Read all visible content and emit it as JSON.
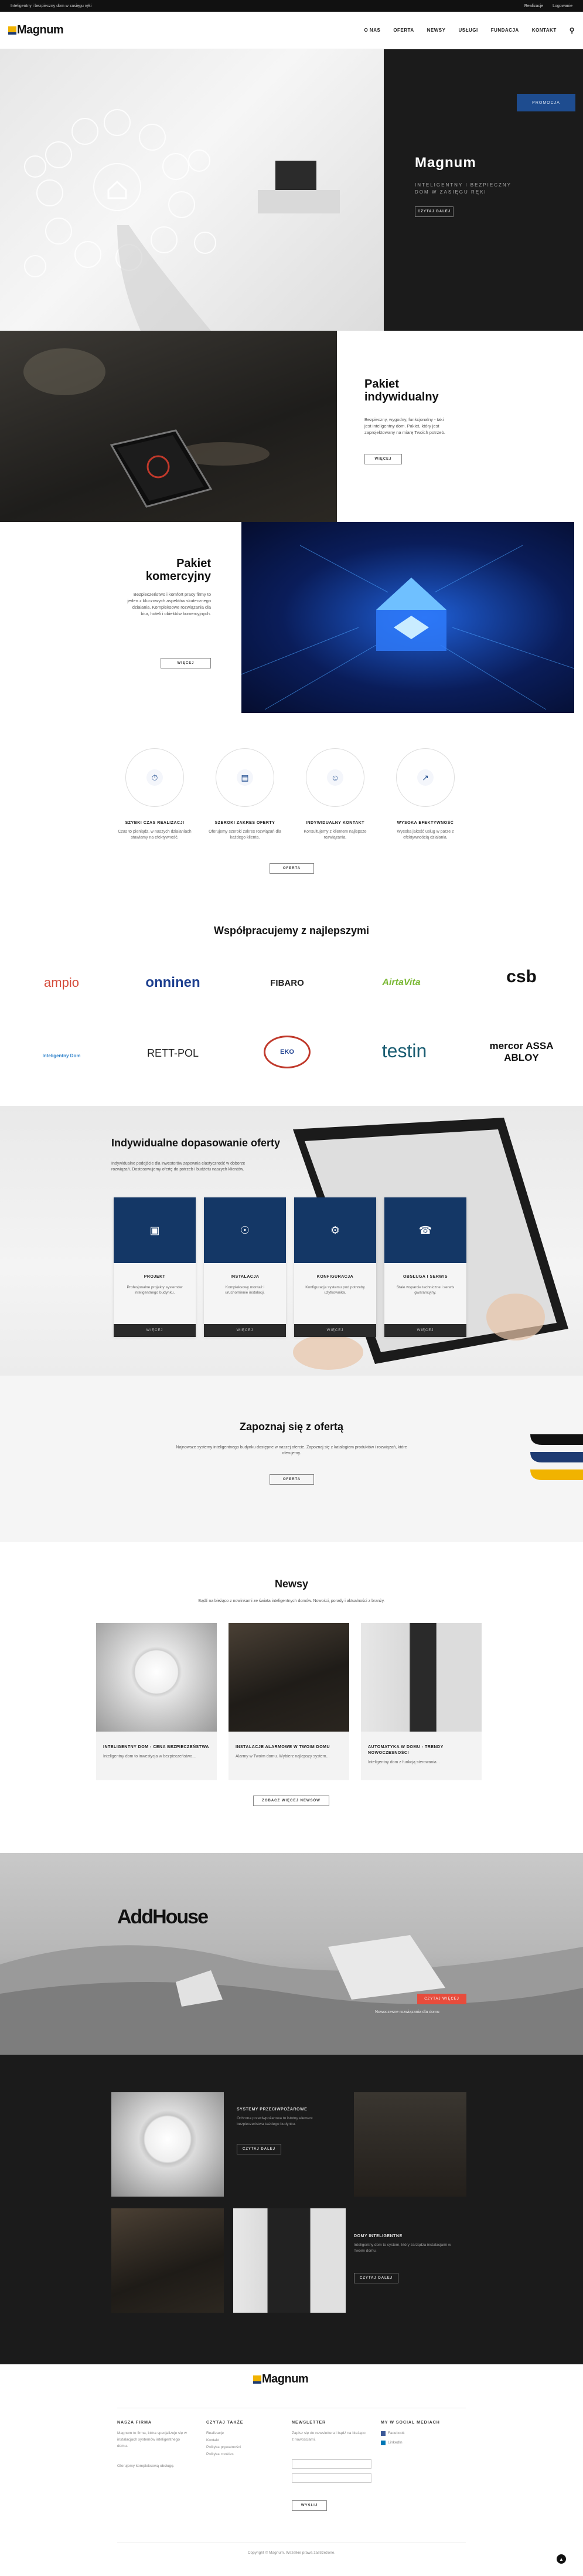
{
  "topbar": {
    "left_text": "Inteligentny i bezpieczny dom w zasięgu ręki",
    "links": [
      "Realizacje",
      "Logowanie"
    ]
  },
  "header": {
    "brand": "Magnum",
    "nav": [
      "O NAS",
      "OFERTA",
      "NEWSY",
      "USŁUGI",
      "FUNDACJA",
      "KONTAKT"
    ]
  },
  "hero": {
    "badge": "PROMOCJA",
    "title": "Magnum",
    "subtitle": "INTELIGENTNY I BEZPIECZNY DOM W ZASIĘGU RĘKI",
    "button": "CZYTAJ DALEJ"
  },
  "pakiet_ind": {
    "title": "Pakiet indywidualny",
    "text": "Bezpieczny, wygodny, funkcjonalny - taki jest inteligentny dom. Pakiet, który jest zaprojektowany na miarę Twoich potrzeb.",
    "button": "WIĘCEJ"
  },
  "pakiet_kom": {
    "title": "Pakiet komercyjny",
    "text": "Bezpieczeństwo i komfort pracy firmy to jeden z kluczowych aspektów skutecznego działania. Kompleksowe rozwiązania dla biur, hoteli i obiektów komercyjnych.",
    "button": "WIĘCEJ"
  },
  "features": {
    "items": [
      {
        "icon": "timer-icon",
        "title": "SZYBKI CZAS REALIZACJI",
        "text": "Czas to pieniądz, w naszych działaniach stawiamy na efektywność."
      },
      {
        "icon": "calendar-icon",
        "title": "SZEROKI ZAKRES OFERTY",
        "text": "Oferujemy szeroki zakres rozwiązań dla każdego klienta."
      },
      {
        "icon": "contact-icon",
        "title": "INDYWIDUALNY KONTAKT",
        "text": "Konsultujemy z klientem najlepsze rozwiązania."
      },
      {
        "icon": "chart-icon",
        "title": "WYSOKA EFEKTYWNOŚĆ",
        "text": "Wysoka jakość usług w parze z efektywnością działania."
      }
    ],
    "button": "OFERTA"
  },
  "partners": {
    "title": "Współpracujemy z najlepszymi",
    "logos": [
      "ampio",
      "onninen",
      "FIBARO",
      "AirtaVita",
      "csb",
      "Inteligentny Dom",
      "RETT-POL",
      "EKO",
      "testin",
      "mercor ASSA ABLOY"
    ]
  },
  "dopasowanie": {
    "title": "Indywidualne dopasowanie oferty",
    "text": "Indywidualne podejście dla inwestorów zapewnia elastyczność w doborze rozwiązań. Dostosowujemy ofertę do potrzeb i budżetu naszych klientów.",
    "cards": [
      {
        "icon": "project-icon",
        "title": "PROJEKT",
        "text": "Profesjonalne projekty systemów inteligentnego budynku.",
        "more": "WIĘCEJ"
      },
      {
        "icon": "install-icon",
        "title": "INSTALACJA",
        "text": "Kompleksowy montaż i uruchomienie instalacji.",
        "more": "WIĘCEJ"
      },
      {
        "icon": "gear-icon",
        "title": "KONFIGURACJA",
        "text": "Konfiguracja systemu pod potrzeby użytkownika.",
        "more": "WIĘCEJ"
      },
      {
        "icon": "phone-icon",
        "title": "OBSŁUGA I SERWIS",
        "text": "Stałe wsparcie techniczne i serwis gwarancyjny.",
        "more": "WIĘCEJ"
      }
    ]
  },
  "zapoznaj": {
    "title": "Zapoznaj się z ofertą",
    "text": "Najnowsze systemy inteligentnego budynku dostępne w naszej ofercie. Zapoznaj się z katalogiem produktów i rozwiązań, które oferujemy.",
    "button": "OFERTA"
  },
  "news": {
    "title": "Newsy",
    "text": "Bądź na bieżąco z nowinkami ze świata inteligentnych domów. Nowości, porady i aktualności z branży.",
    "items": [
      {
        "title": "INTELIGENTNY DOM - CENA BEZPIECZEŃSTWA",
        "text": "Inteligentny dom to inwestycja w bezpieczeństwo..."
      },
      {
        "title": "INSTALACJE ALARMOWE W TWOIM DOMU",
        "text": "Alarmy w Twoim domu. Wybierz najlepszy system..."
      },
      {
        "title": "AUTOMATYKA W DOMU - TRENDY NOWOCZESNOŚCI",
        "text": "Inteligentny dom z funkcją sterowania..."
      }
    ],
    "button": "ZOBACZ WIĘCEJ NEWSÓW"
  },
  "addhouse": {
    "brand": "AddHouse",
    "button": "CZYTAJ WIĘCEJ",
    "text": "Nowoczesne rozwiązania dla domu"
  },
  "promo": {
    "items": [
      {
        "title": "SYSTEMY PRZECIWPOŻAROWE",
        "text": "Ochrona przeciwpożarowa to istotny element bezpieczeństwa każdego budynku.",
        "button": "CZYTAJ DALEJ"
      },
      {
        "title": "DOMY INTELIGENTNE",
        "text": "Inteligentny dom to system, który zarządza instalacjami w Twoim domu.",
        "button": "CZYTAJ DALEJ"
      }
    ]
  },
  "footer": {
    "brand": "Magnum",
    "cols": [
      {
        "title": "NASZA FIRMA",
        "lines": [
          "Magnum to firma, która specjalizuje się w instalacjach systemów inteligentnego domu.",
          "Oferujemy kompleksową obsługę."
        ]
      },
      {
        "title": "CZYTAJ TAKŻE",
        "lines": [
          "Realizacje",
          "Kontakt",
          "Polityka prywatności",
          "Polityka cookies"
        ]
      },
      {
        "title": "NEWSLETTER",
        "lines": [
          "Zapisz się do newslettera i bądź na bieżąco z nowościami."
        ]
      },
      {
        "title": "MY W SOCIAL MEDIACH",
        "lines": [
          "Facebook",
          "LinkedIn"
        ]
      }
    ],
    "newsletter_button": "WYŚLIJ",
    "copyright": "Copyright © Magnum. Wszelkie prawa zastrzeżone."
  }
}
